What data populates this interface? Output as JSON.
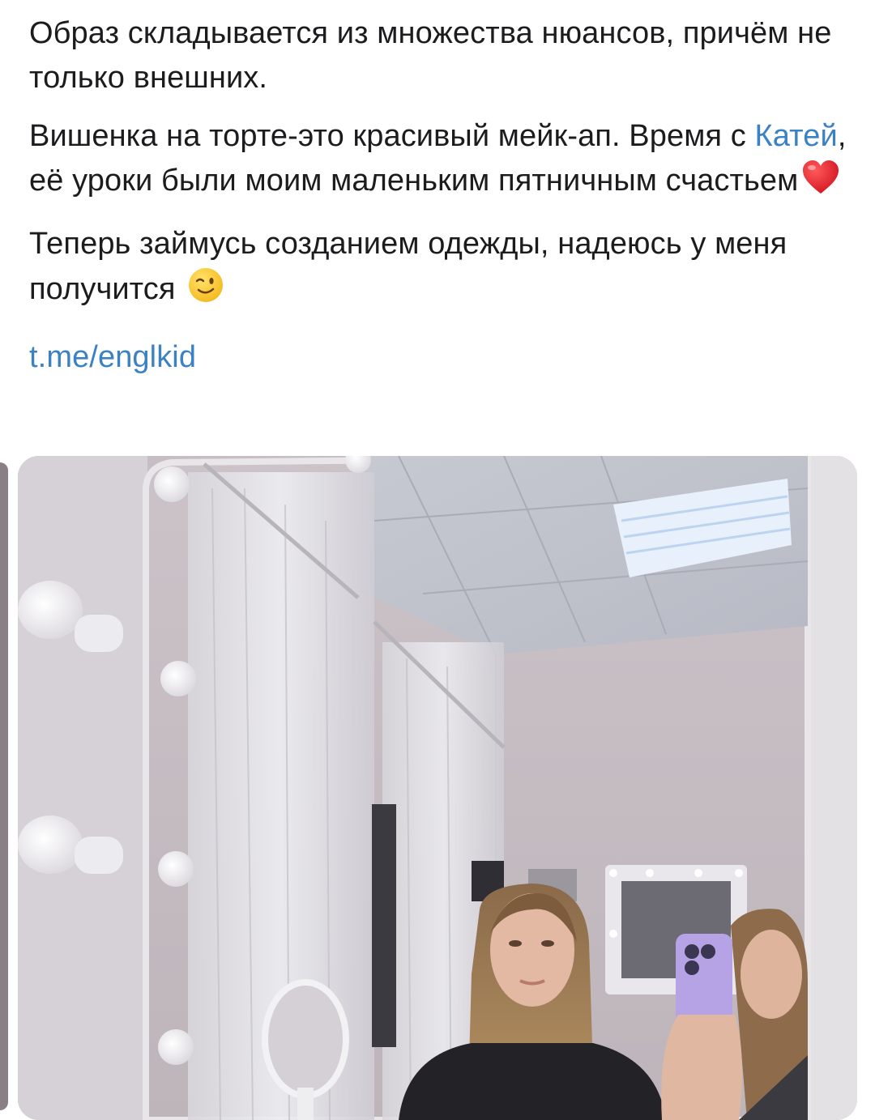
{
  "post": {
    "paragraph_1": "Образ складывается из множества нюансов, причём не только внешних.",
    "paragraph_2_before": "Вишенка на торте-это красивый мейк-ап. Время с ",
    "paragraph_2_mention": "Катей",
    "paragraph_2_after": ", её уроки были моим маленьким пятничным счастьем",
    "paragraph_3": "Теперь займусь созданием одежды, надеюсь у меня получится",
    "link": "t.me/englkid",
    "icons": [
      "red-heart-emoji",
      "winking-face-emoji"
    ]
  },
  "colors": {
    "text": "#1c1c1e",
    "link": "#3b82c4",
    "background": "#ffffff"
  },
  "media": {
    "type": "photo",
    "subject": "mirror selfie in makeup studio"
  }
}
